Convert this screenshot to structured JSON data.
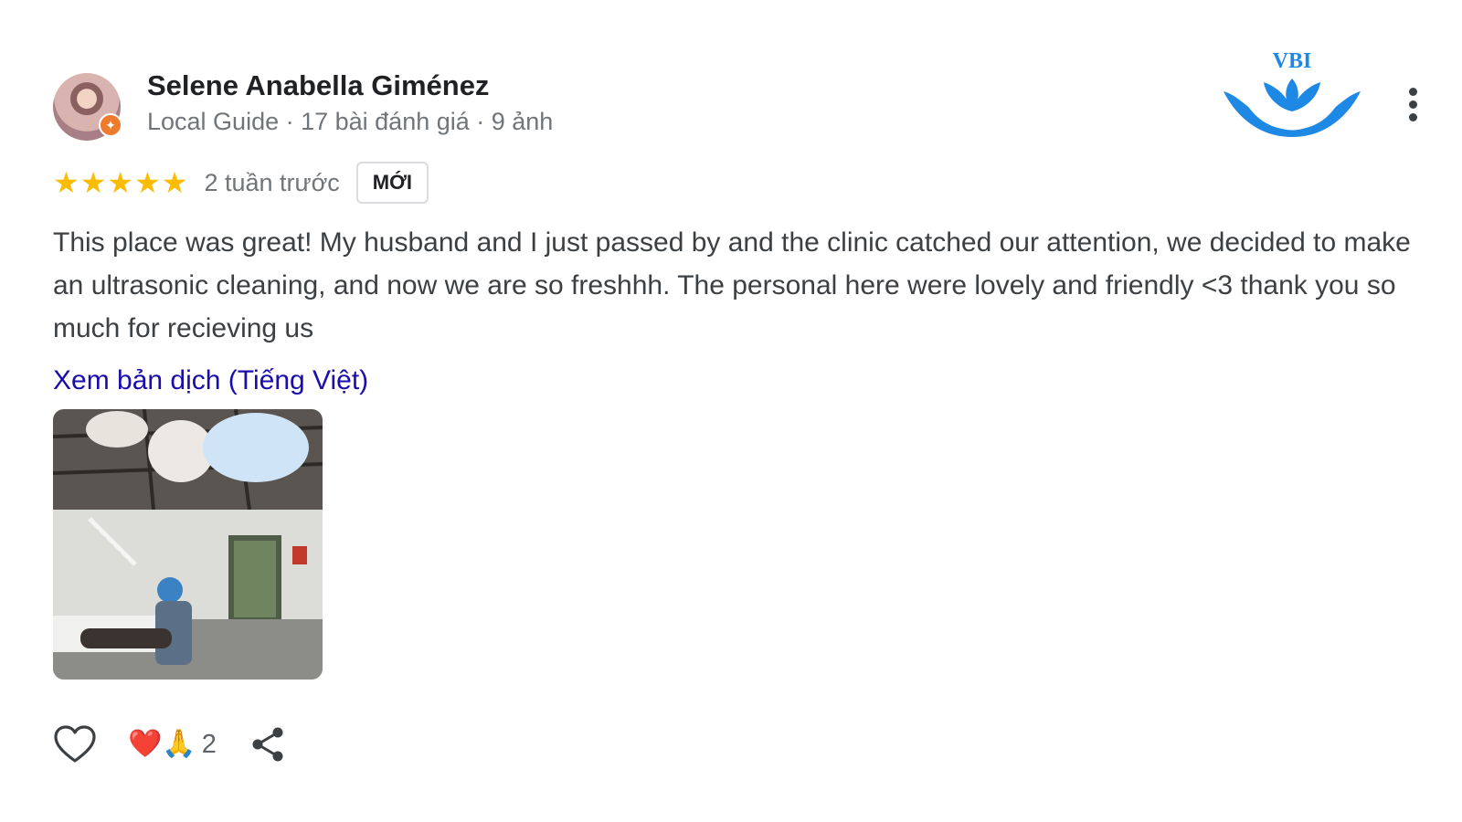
{
  "reviewer": {
    "name": "Selene Anabella Giménez",
    "meta": "Local Guide · 17 bài đánh giá · 9 ảnh",
    "avatar_icon": "avatar-photo",
    "badge_icon": "local-guide-star-icon"
  },
  "logo": {
    "text": "VBI",
    "color": "#1e88e5"
  },
  "rating": {
    "stars": 5,
    "max": 5,
    "time": "2 tuần trước",
    "badge": "MỚI",
    "star_color": "#fbbc04"
  },
  "review_text": "This place was great! My husband and I just passed by and the clinic catched our attention, we decided to make an ultrasonic cleaning, and now we are so freshhh. The personal here were lovely and friendly <3 thank you so much for recieving us",
  "translate_link": "Xem bản dịch (Tiếng Việt)",
  "photo": {
    "icon": "clinic-photo"
  },
  "actions": {
    "reactions": "❤️🙏",
    "reaction_count": "2",
    "like_icon": "heart-outline-icon",
    "share_icon": "share-icon"
  }
}
